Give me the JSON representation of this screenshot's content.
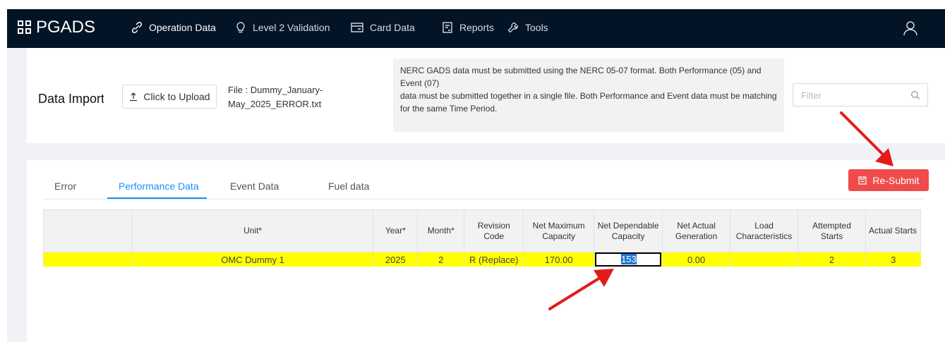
{
  "app": {
    "brand": "PGADS"
  },
  "nav": {
    "items": [
      {
        "label": "Operation Data"
      },
      {
        "label": "Level 2 Validation"
      },
      {
        "label": "Card Data"
      },
      {
        "label": "Reports"
      },
      {
        "label": "Tools"
      }
    ]
  },
  "import": {
    "title": "Data Import",
    "upload_label": "Click to Upload",
    "file_label": "File : Dummy_January-May_2025_ERROR.txt",
    "notice_line1": "NERC GADS data must be submitted using the NERC 05-07 format. Both Performance (05) and Event (07)",
    "notice_line2": "data must be submitted together in a single file. Both Performance and Event data must be matching",
    "notice_line3": "for the same Time Period.",
    "filter_placeholder": "Filter"
  },
  "tabs": [
    {
      "label": "Error",
      "active": false
    },
    {
      "label": "Performance Data",
      "active": true
    },
    {
      "label": "Event Data",
      "active": false
    },
    {
      "label": "Fuel data",
      "active": false
    }
  ],
  "actions": {
    "resubmit_label": "Re-Submit"
  },
  "table": {
    "headers": [
      "",
      "Unit*",
      "Year*",
      "Month*",
      "Revision Code",
      "Net Maximum Capacity",
      "Net Dependable Capacity",
      "Net Actual Generation",
      "Load Characteristics",
      "Attempted Starts",
      "Actual Starts"
    ],
    "row": {
      "blank": "",
      "unit": "OMC Dummy 1",
      "year": "2025",
      "month": "2",
      "revision_code": "R (Replace)",
      "net_max_capacity": "170.00",
      "net_dependable_capacity": "153",
      "net_actual_generation": "0.00",
      "load_characteristics": "",
      "attempted_starts": "2",
      "actual_starts": "3"
    }
  },
  "colors": {
    "navbar": "#021426",
    "accent": "#1890ff",
    "resubmit": "#f04b4b",
    "row_highlight": "#ffff00",
    "annotation_arrow": "#e31b1b"
  }
}
